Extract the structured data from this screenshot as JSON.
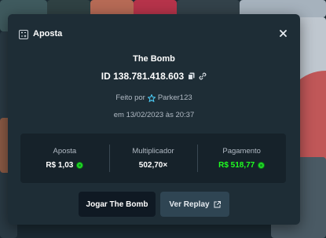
{
  "modal": {
    "title": "Aposta",
    "icons": {
      "header": "bet-receipt-icon",
      "close": "close-icon"
    }
  },
  "game": {
    "name": "The Bomb",
    "id_text": "ID 138.781.418.603",
    "icons": [
      "copy-icon",
      "link-icon"
    ]
  },
  "made_by": {
    "prefix": "Feito por",
    "user": "Parker123",
    "icon": "star-badge-icon"
  },
  "date_text": "em 13/02/2023 às 20:37",
  "stats": {
    "bet": {
      "label": "Aposta",
      "value": "R$ 1,03"
    },
    "multiplier": {
      "label": "Multiplicador",
      "value": "502,70×"
    },
    "payout": {
      "label": "Pagamento",
      "value": "R$ 518,77"
    }
  },
  "actions": {
    "play_label": "Jogar The Bomb",
    "replay_label": "Ver Replay"
  },
  "colors": {
    "payout_green": "#1fff20",
    "modal_bg": "#1e2d36",
    "stats_bg": "#16222a"
  }
}
